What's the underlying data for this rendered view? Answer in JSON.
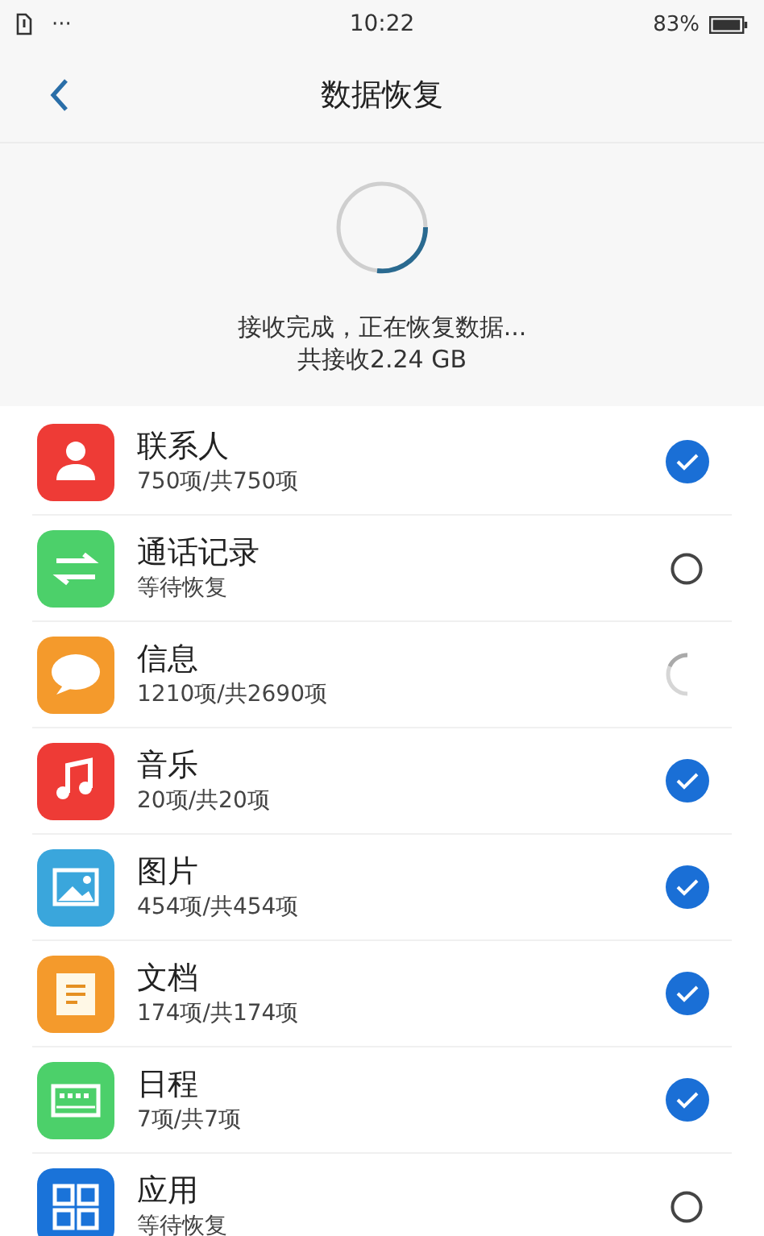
{
  "status_bar": {
    "time": "10:22",
    "dots": "···",
    "battery": "83%"
  },
  "header": {
    "title": "数据恢复"
  },
  "progress": {
    "message": "接收完成，正在恢复数据...",
    "received": "共接收2.24 GB"
  },
  "items": [
    {
      "kind": "contacts",
      "color": "#ee3b36",
      "title": "联系人",
      "detail": "750项/共750项",
      "checked": true,
      "in_progress": false
    },
    {
      "kind": "calls",
      "color": "#4cd06a",
      "title": "通话记录",
      "detail": "等待恢复",
      "checked": false,
      "in_progress": false
    },
    {
      "kind": "messages",
      "color": "#f49a2c",
      "title": "信息",
      "detail": "1210项/共2690项",
      "checked": false,
      "in_progress": true
    },
    {
      "kind": "music",
      "color": "#ee3b36",
      "title": "音乐",
      "detail": "20项/共20项",
      "checked": true,
      "in_progress": false
    },
    {
      "kind": "photos",
      "color": "#3aa6dc",
      "title": "图片",
      "detail": "454项/共454项",
      "checked": true,
      "in_progress": false
    },
    {
      "kind": "documents",
      "color": "#f49a2c",
      "title": "文档",
      "detail": "174项/共174项",
      "checked": true,
      "in_progress": false
    },
    {
      "kind": "calendar",
      "color": "#4cd06a",
      "title": "日程",
      "detail": "7项/共7项",
      "checked": true,
      "in_progress": false
    },
    {
      "kind": "apps",
      "color": "#1a73d9",
      "title": "应用",
      "detail": "等待恢复",
      "checked": false,
      "in_progress": false
    }
  ]
}
